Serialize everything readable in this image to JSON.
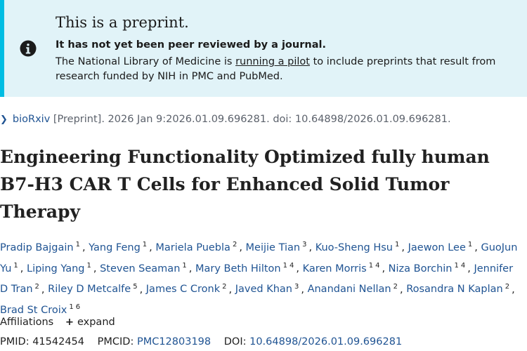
{
  "banner": {
    "title": "This is a preprint.",
    "strong": "It has not yet been peer reviewed by a journal.",
    "text_before": "The National Library of Medicine is ",
    "link": "running a pilot",
    "text_after": " to include preprints that result from research funded by NIH in PMC and PubMed.",
    "icon": "info-icon"
  },
  "citation": {
    "source": "bioRxiv",
    "details": " [Preprint]. 2026 Jan 9:2026.01.09.696281. doi: 10.64898/2026.01.09.696281."
  },
  "article": {
    "title": "Engineering Functionality Optimized fully human B7-H3 CAR T Cells for Enhanced Solid Tumor Therapy"
  },
  "authors": [
    {
      "name": "Pradip Bajgain",
      "affs": [
        "1"
      ]
    },
    {
      "name": "Yang Feng",
      "affs": [
        "1"
      ]
    },
    {
      "name": "Mariela Puebla",
      "affs": [
        "2"
      ]
    },
    {
      "name": "Meijie Tian",
      "affs": [
        "3"
      ]
    },
    {
      "name": "Kuo-Sheng Hsu",
      "affs": [
        "1"
      ]
    },
    {
      "name": "Jaewon Lee",
      "affs": [
        "1"
      ]
    },
    {
      "name": "GuoJun Yu",
      "affs": [
        "1"
      ]
    },
    {
      "name": "Liping Yang",
      "affs": [
        "1"
      ]
    },
    {
      "name": "Steven Seaman",
      "affs": [
        "1"
      ]
    },
    {
      "name": "Mary Beth Hilton",
      "affs": [
        "1",
        "4"
      ]
    },
    {
      "name": "Karen Morris",
      "affs": [
        "1",
        "4"
      ]
    },
    {
      "name": "Niza Borchin",
      "affs": [
        "1",
        "4"
      ]
    },
    {
      "name": "Jennifer D Tran",
      "affs": [
        "2"
      ]
    },
    {
      "name": "Riley D Metcalfe",
      "affs": [
        "5"
      ]
    },
    {
      "name": "James C Cronk",
      "affs": [
        "2"
      ]
    },
    {
      "name": "Javed Khan",
      "affs": [
        "3"
      ]
    },
    {
      "name": "Anandani Nellan",
      "affs": [
        "2"
      ]
    },
    {
      "name": "Rosandra N Kaplan",
      "affs": [
        "2"
      ]
    },
    {
      "name": "Brad St Croix",
      "affs": [
        "1",
        "6"
      ]
    }
  ],
  "affiliations": {
    "label": "Affiliations",
    "expand_label": "expand"
  },
  "identifiers": {
    "pmid_label": "PMID: ",
    "pmid": "41542454",
    "pmcid_label": "PMCID: ",
    "pmcid": "PMC12803198",
    "doi_label": "DOI: ",
    "doi": "10.64898/2026.01.09.696281"
  }
}
